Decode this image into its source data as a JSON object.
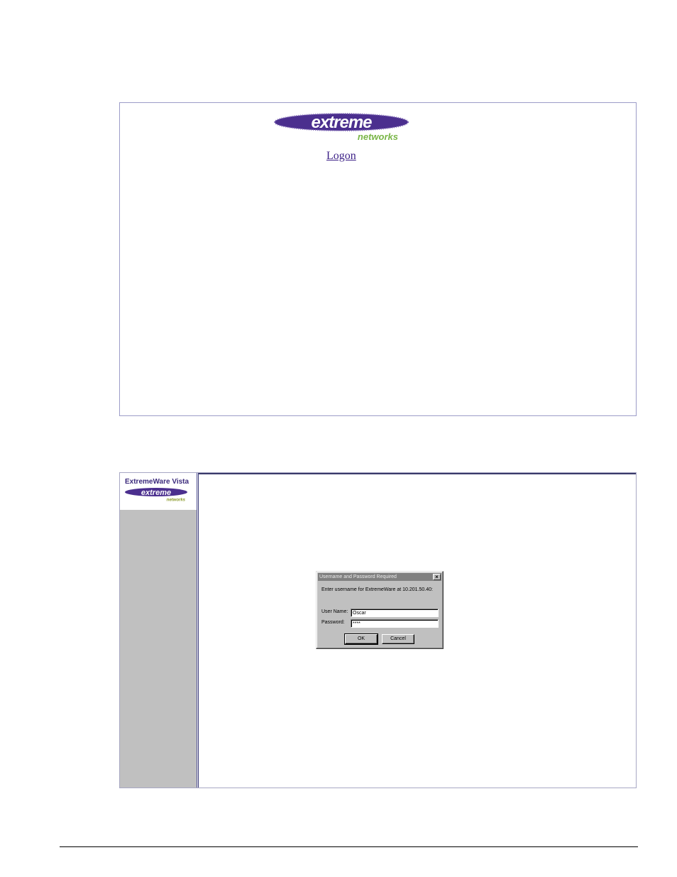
{
  "screen1": {
    "logo": {
      "brand_word": "extreme",
      "brand_sub": "networks",
      "purple": "#4b2f8e",
      "green": "#7ab648"
    },
    "logon_link": "Logon"
  },
  "screen2": {
    "sidebar": {
      "title": "ExtremeWare Vista",
      "logo": {
        "brand_word": "extreme",
        "brand_sub": "networks"
      },
      "background": "#c0c0c0"
    },
    "dialog": {
      "title": "Username and Password Required",
      "close_glyph": "×",
      "prompt": "Enter username for ExtremeWare at 10.201.50.40:",
      "username_label": "User Name:",
      "username_value": "Oscar",
      "password_label": "Password:",
      "password_value": "****",
      "ok_label": "OK",
      "cancel_label": "Cancel"
    }
  }
}
